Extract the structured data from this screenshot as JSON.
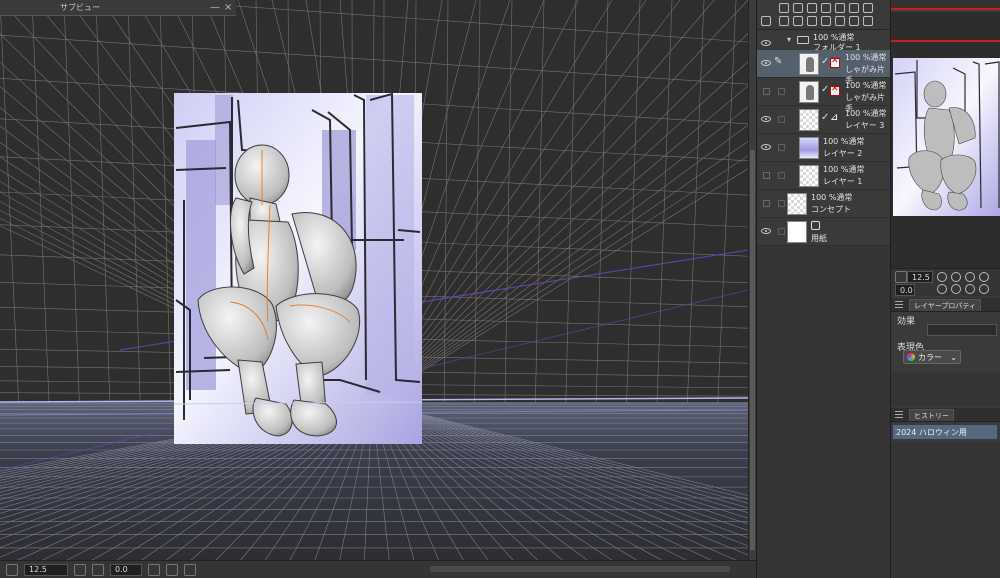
{
  "subview": {
    "title": "サブビュー",
    "minimize": "—",
    "close": "×"
  },
  "layers": [
    {
      "id": "folder",
      "blend": "100 %通常",
      "name": "フォルダー 1"
    },
    {
      "id": "shagami1",
      "blend": "100 %通常",
      "name": "しゃがみ片手"
    },
    {
      "id": "shagami2",
      "blend": "100 %通常",
      "name": "しゃがみ片手"
    },
    {
      "id": "layer3",
      "blend": "100 %通常",
      "name": "レイヤー 3"
    },
    {
      "id": "layer2",
      "blend": "100 %通常",
      "name": "レイヤー 2"
    },
    {
      "id": "layer1",
      "blend": "100 %通常",
      "name": "レイヤー 1"
    },
    {
      "id": "concept",
      "blend": "100 %通常",
      "name": "コンセプト"
    },
    {
      "id": "paper",
      "blend": "",
      "name": "用紙"
    }
  ],
  "bottom_bar": {
    "zoom": "12.5",
    "angle": "0.0"
  },
  "navigator": {
    "zoom": "12.5",
    "angle": "0.0"
  },
  "layer_property": {
    "tab": "レイヤープロパティ",
    "effect_label": "効果",
    "expression_label": "表現色",
    "color_value": "カラー"
  },
  "history": {
    "tab": "ヒストリー",
    "items": [
      "2024 ハロウィン用"
    ]
  },
  "colors": {
    "selection": "#56687e",
    "accent_red": "#c81e1e",
    "grid": "#8a8a8a"
  }
}
